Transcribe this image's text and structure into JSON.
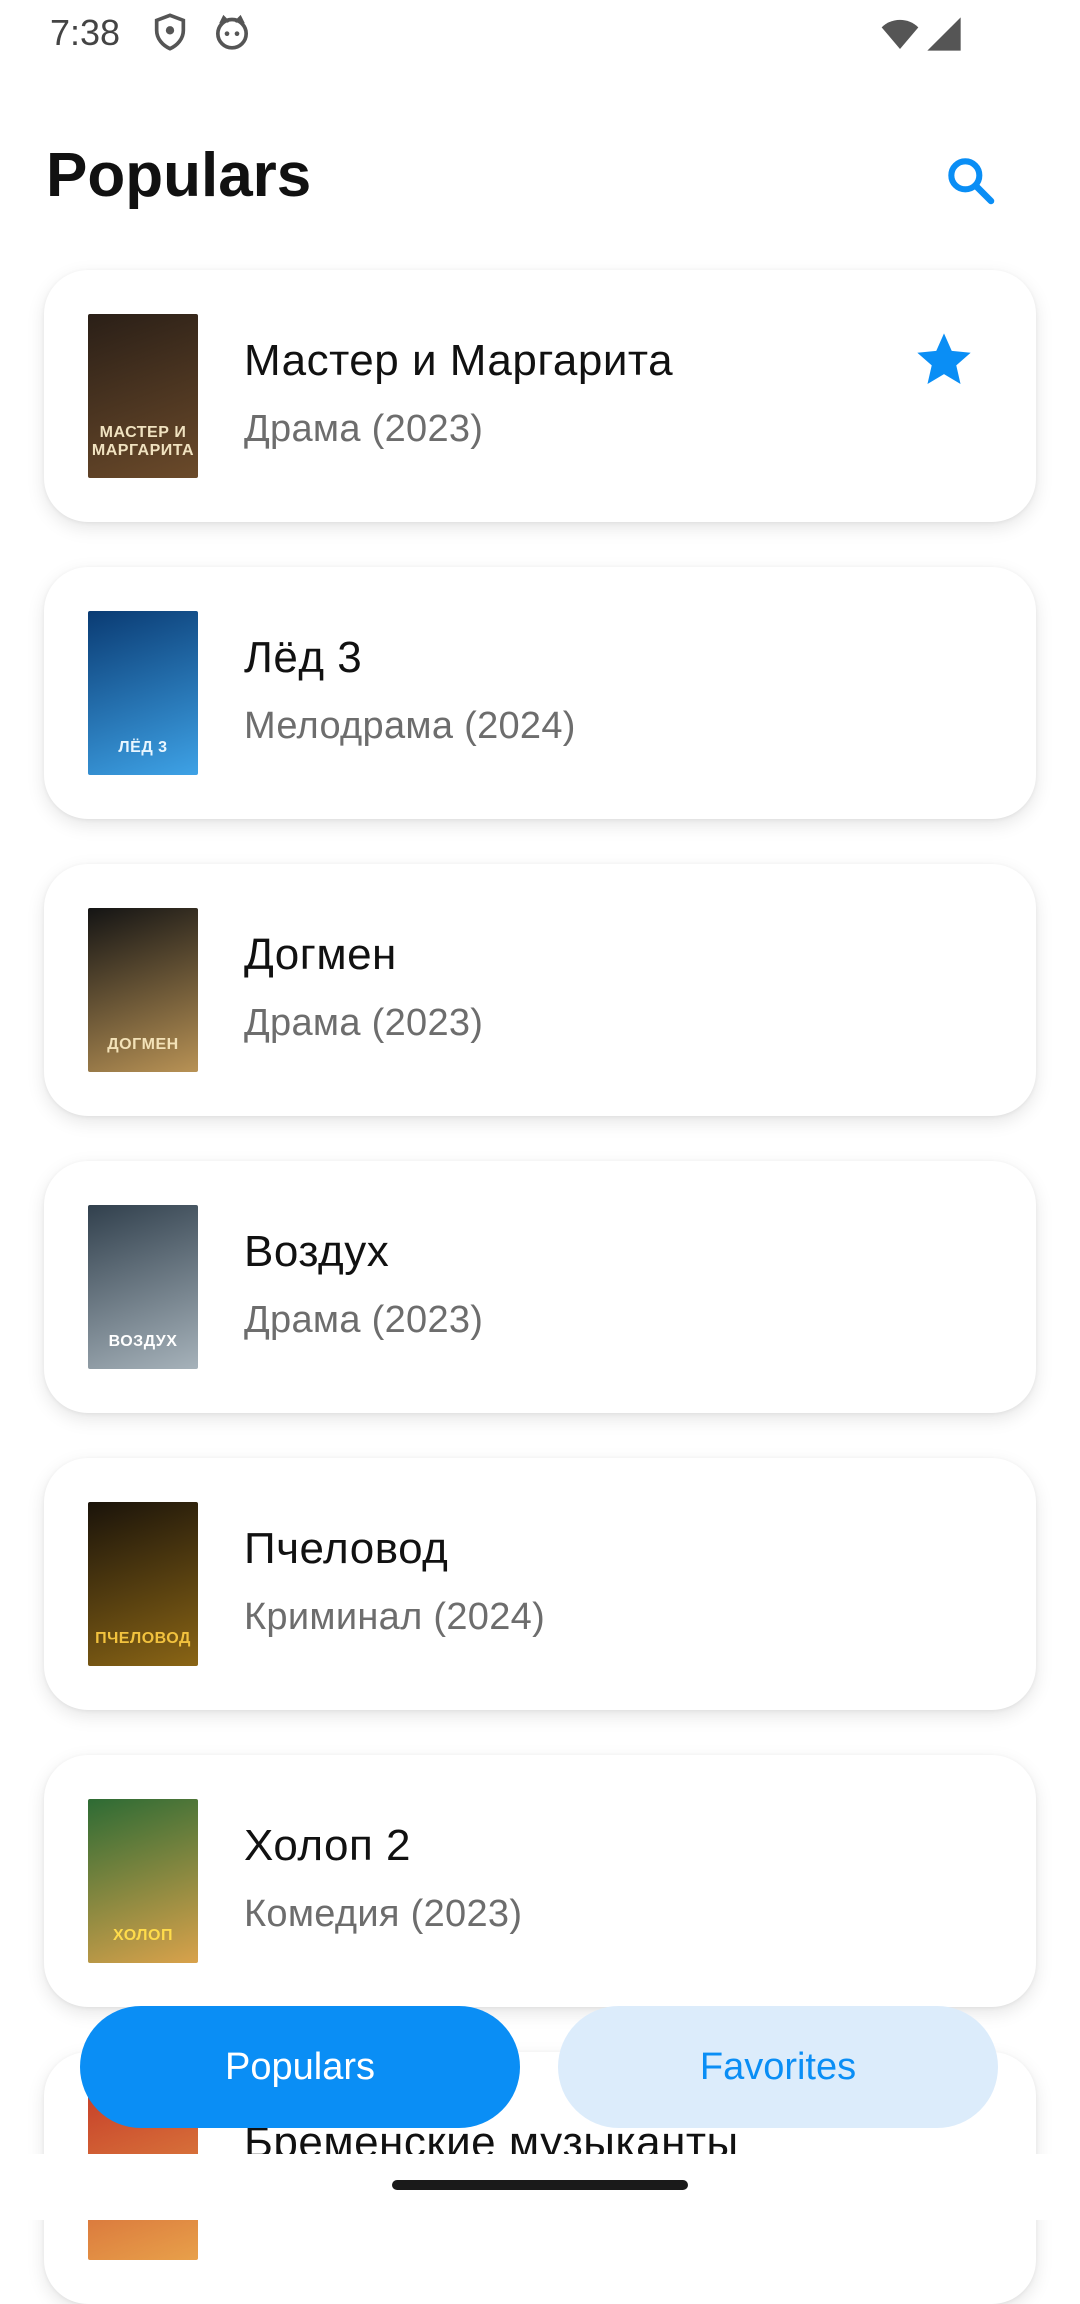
{
  "status_bar": {
    "time": "7:38",
    "icons": [
      "shield-icon",
      "cat-icon",
      "wifi-icon",
      "signal-icon"
    ]
  },
  "header": {
    "title": "Populars",
    "search_icon": "search-icon",
    "accent": "#0a8ef5"
  },
  "movies": [
    {
      "title": "Мастер и Маргарита",
      "meta": "Драма (2023)",
      "favorite": true,
      "poster_text": "МАСТЕР И МАРГАРИТА",
      "poster_colors": [
        "#2a1f17",
        "#6b4a2a"
      ],
      "poster_text_color": "#f0e2c0"
    },
    {
      "title": "Лёд 3",
      "meta": "Мелодрама (2024)",
      "favorite": false,
      "poster_text": "ЛЁД 3",
      "poster_colors": [
        "#0a3b73",
        "#3ea2e6"
      ],
      "poster_text_color": "#e9f6ff"
    },
    {
      "title": "Догмен",
      "meta": "Драма (2023)",
      "favorite": false,
      "poster_text": "ДОГМЕН",
      "poster_colors": [
        "#141414",
        "#b89255"
      ],
      "poster_text_color": "#f3e2b8"
    },
    {
      "title": "Воздух",
      "meta": "Драма (2023)",
      "favorite": false,
      "poster_text": "ВОЗДУХ",
      "poster_colors": [
        "#31404d",
        "#a6b2ba"
      ],
      "poster_text_color": "#ffffff"
    },
    {
      "title": "Пчеловод",
      "meta": "Криминал (2024)",
      "favorite": false,
      "poster_text": "ПЧЕЛОВОД",
      "poster_colors": [
        "#1a130a",
        "#8a6515"
      ],
      "poster_text_color": "#f2c23e"
    },
    {
      "title": "Холоп 2",
      "meta": "Комедия (2023)",
      "favorite": false,
      "poster_text": "ХОЛОП",
      "poster_colors": [
        "#2d6b34",
        "#d9a24b"
      ],
      "poster_text_color": "#ffdc4b"
    },
    {
      "title": "Бременские музыканты",
      "meta": "",
      "favorite": false,
      "poster_text": "",
      "poster_colors": [
        "#c7422a",
        "#e8a04a"
      ],
      "poster_text_color": "#ffffff"
    }
  ],
  "tabs": {
    "populars": "Populars",
    "favorites": "Favorites"
  }
}
